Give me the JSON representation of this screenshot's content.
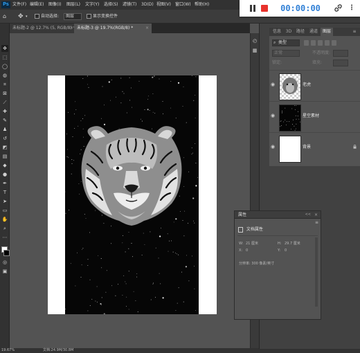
{
  "app": {
    "logo": "Ps"
  },
  "menu": [
    "文件(F)",
    "编辑(E)",
    "图像(I)",
    "图层(L)",
    "文字(Y)",
    "选择(S)",
    "滤镜(T)",
    "3D(D)",
    "视图(V)",
    "窗口(W)",
    "帮助(H)"
  ],
  "recorder": {
    "time": "00:00:00",
    "pause_icon": "pause-icon",
    "stop_icon": "stop-icon",
    "link_icon": "link-icon",
    "more_icon": "more-icon"
  },
  "options": {
    "auto_select_label": "自动选择:",
    "auto_select_value": "图层",
    "show_transform_label": "显示变换控件"
  },
  "tabs": [
    {
      "label": "未标题-2 @ 12.7% (5, RGB/8) *",
      "close": "×"
    },
    {
      "label": "未标题-3 @ 19.7%(RGB/8) *",
      "close": "×"
    }
  ],
  "layers_panel": {
    "tabs": [
      "信息",
      "3D",
      "路径",
      "通道",
      "图层"
    ],
    "filter_label": "类型",
    "blend_mode": "正常",
    "opacity_label": "不透明度:",
    "lock_label": "锁定:",
    "fill_label": "填充:",
    "layers": [
      {
        "name": "老虎",
        "visible": true
      },
      {
        "name": "星空素材",
        "visible": true
      },
      {
        "name": "背景",
        "visible": true,
        "locked": true
      }
    ]
  },
  "properties": {
    "title": "属性",
    "collapse": "<<",
    "close": "×",
    "menu": "≡",
    "section": "文档属性",
    "w_label": "W:",
    "w_value": "21 厘米",
    "h_label": "H:",
    "h_value": "29.7 厘米",
    "x_label": "X:",
    "x_value": "0",
    "y_label": "Y:",
    "y_value": "0",
    "resolution": "分辨率: 300 像素/英寸"
  },
  "status": {
    "zoom": "19.67%",
    "doc": "文档:24.9M/30.8M"
  },
  "colors": {
    "accent": "#31a8ff",
    "stop": "#e8322c",
    "timer": "#2f7fd6"
  }
}
